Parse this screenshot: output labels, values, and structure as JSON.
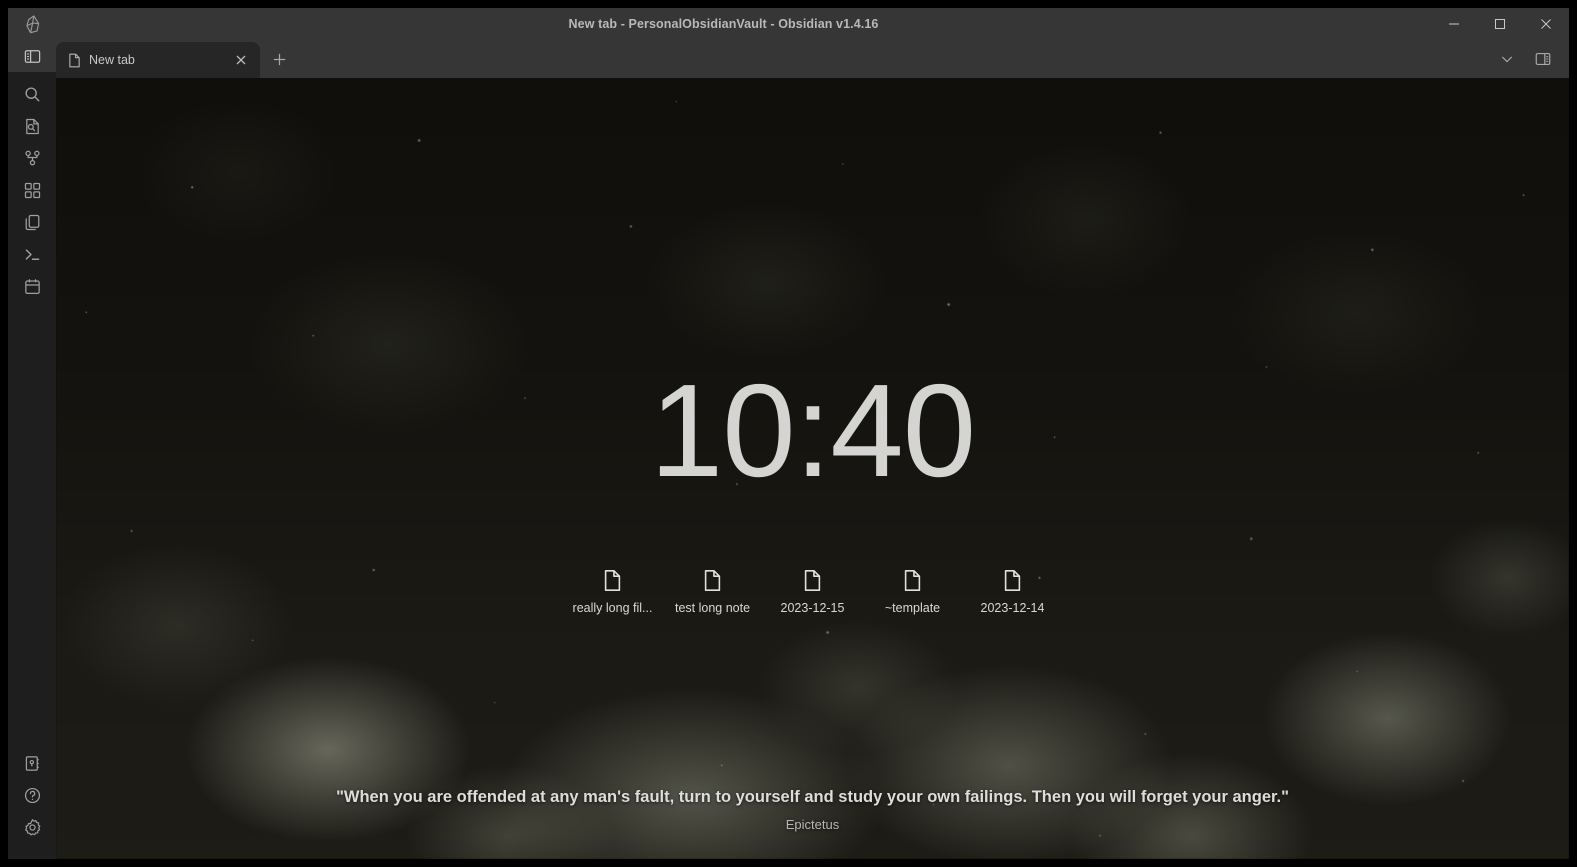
{
  "window": {
    "title": "New tab - PersonalObsidianVault - Obsidian v1.4.16",
    "app_logo": "obsidian-gem-logo",
    "controls": {
      "minimize": "minimize-icon",
      "maximize": "maximize-icon",
      "close": "close-icon"
    }
  },
  "tabbar": {
    "tabs": [
      {
        "label": "New tab",
        "icon": "file-icon",
        "close": "close-icon",
        "active": true
      }
    ],
    "new_tab_label": "+",
    "tab_list_icon": "chevron-down-icon",
    "right_sidebar_toggle_icon": "right-sidebar-toggle-icon"
  },
  "ribbon": {
    "top_items": [
      {
        "name": "toggle-left-sidebar",
        "icon": "left-sidebar-toggle-icon",
        "active": true
      },
      {
        "name": "search",
        "icon": "search-icon",
        "active": false
      },
      {
        "name": "quick-switcher",
        "icon": "file-search-icon",
        "active": false
      },
      {
        "name": "graph-view",
        "icon": "graph-icon",
        "active": false
      },
      {
        "name": "canvas",
        "icon": "grid-squares-icon",
        "active": false
      },
      {
        "name": "open-copy",
        "icon": "copy-files-icon",
        "active": false
      },
      {
        "name": "terminal",
        "icon": "terminal-icon",
        "active": false
      },
      {
        "name": "calendar",
        "icon": "calendar-icon",
        "active": false
      }
    ],
    "bottom_items": [
      {
        "name": "open-another-vault",
        "icon": "vault-icon"
      },
      {
        "name": "help",
        "icon": "help-circle-icon"
      },
      {
        "name": "settings",
        "icon": "gear-icon"
      }
    ]
  },
  "home": {
    "clock": "10:40",
    "recent_files": [
      {
        "label": "really long fil...",
        "icon": "file-icon"
      },
      {
        "label": "test long note",
        "icon": "file-icon"
      },
      {
        "label": "2023-12-15",
        "icon": "file-icon"
      },
      {
        "label": "~template",
        "icon": "file-icon"
      },
      {
        "label": "2023-12-14",
        "icon": "file-icon"
      }
    ],
    "quote": "\"When you are offended at any man's fault, turn to yourself and study your own failings. Then you will forget your anger.\"",
    "quote_author": "Epictetus"
  },
  "colors": {
    "titlebar_bg": "#363636",
    "ribbon_bg": "#1e1e1e",
    "tab_active_bg": "#262626",
    "text_primary": "#d4d4d2",
    "text_muted": "#b6b6b4",
    "window_border": "#000000"
  }
}
